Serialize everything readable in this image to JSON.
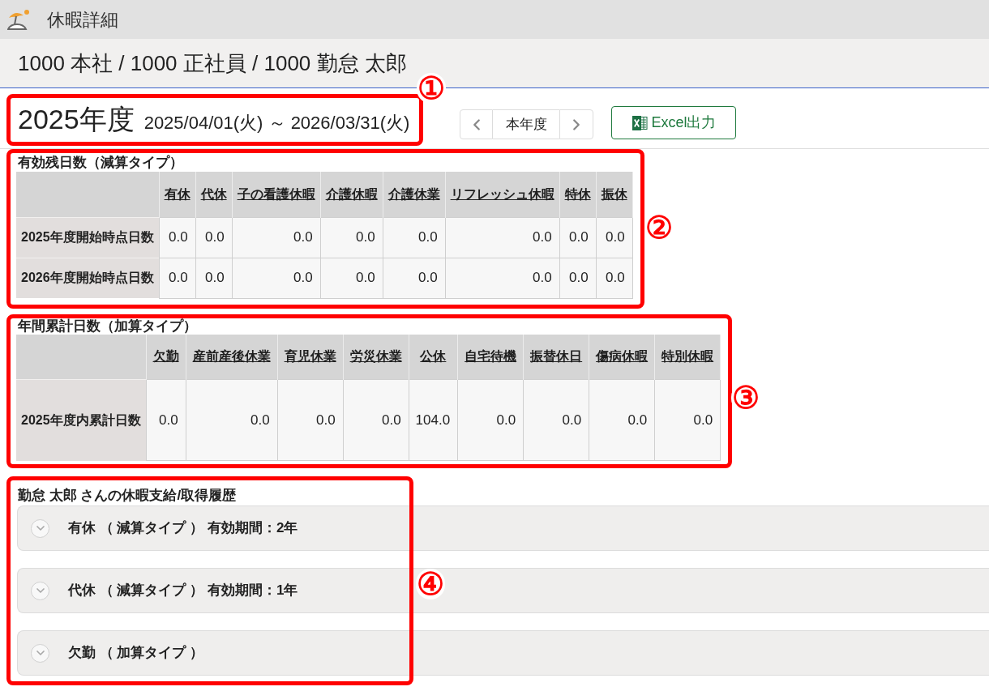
{
  "header": {
    "title": "休暇詳細"
  },
  "breadcrumb": "1000 本社 / 1000 正社員 / 1000 勤怠 太郎",
  "fiscal_year": {
    "title": "2025年度",
    "range": "2025/04/01(火) ～ 2026/03/31(火)"
  },
  "year_nav": {
    "current": "本年度"
  },
  "export_button": {
    "label": "Excel出力"
  },
  "remaining_days": {
    "title": "有効残日数（減算タイプ）",
    "columns": [
      "有休",
      "代休",
      "子の看護休暇",
      "介護休暇",
      "介護休業",
      "リフレッシュ休暇",
      "特休",
      "振休"
    ],
    "rows": [
      {
        "label": "2025年度開始時点日数",
        "values": [
          "0.0",
          "0.0",
          "0.0",
          "0.0",
          "0.0",
          "0.0",
          "0.0",
          "0.0"
        ]
      },
      {
        "label": "2026年度開始時点日数",
        "values": [
          "0.0",
          "0.0",
          "0.0",
          "0.0",
          "0.0",
          "0.0",
          "0.0",
          "0.0"
        ]
      }
    ]
  },
  "annual_totals": {
    "title": "年間累計日数（加算タイプ）",
    "columns": [
      "欠勤",
      "産前産後休業",
      "育児休業",
      "労災休業",
      "公休",
      "自宅待機",
      "振替休日",
      "傷病休暇",
      "特別休暇"
    ],
    "rows": [
      {
        "label": "2025年度内累計日数",
        "values": [
          "0.0",
          "0.0",
          "0.0",
          "0.0",
          "104.0",
          "0.0",
          "0.0",
          "0.0",
          "0.0"
        ]
      }
    ]
  },
  "history": {
    "title": "勤怠 太郎 さんの休暇支給/取得履歴",
    "items": [
      {
        "label": "有休 （ 減算タイプ ） 有効期間：2年",
        "expanded": false
      },
      {
        "label": "代休 （ 減算タイプ ） 有効期間：1年",
        "expanded": false
      },
      {
        "label": "欠勤 （ 加算タイプ ）",
        "expanded": false
      }
    ]
  },
  "callouts": [
    {
      "label": "①"
    },
    {
      "label": "②"
    },
    {
      "label": "③"
    },
    {
      "label": "④"
    }
  ]
}
